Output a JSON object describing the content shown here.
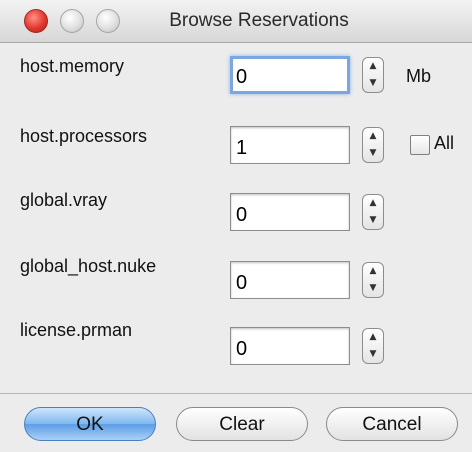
{
  "window": {
    "title": "Browse Reservations"
  },
  "fields": [
    {
      "label": "host.memory",
      "value": "0",
      "focused": true
    },
    {
      "label": "host.processors",
      "value": "1",
      "focused": false
    },
    {
      "label": "global.vray",
      "value": "0",
      "focused": false
    },
    {
      "label": "global_host.nuke",
      "value": "0",
      "focused": false
    },
    {
      "label": "license.prman",
      "value": "0",
      "focused": false
    }
  ],
  "memory_unit": "Mb",
  "all_checkbox": {
    "label": "All",
    "checked": false
  },
  "buttons": {
    "ok": "OK",
    "clear": "Clear",
    "cancel": "Cancel"
  },
  "colors": {
    "default_button": "#6aa8ea",
    "focus_ring": "#7aa7e0",
    "close_button": "#e3372d"
  }
}
